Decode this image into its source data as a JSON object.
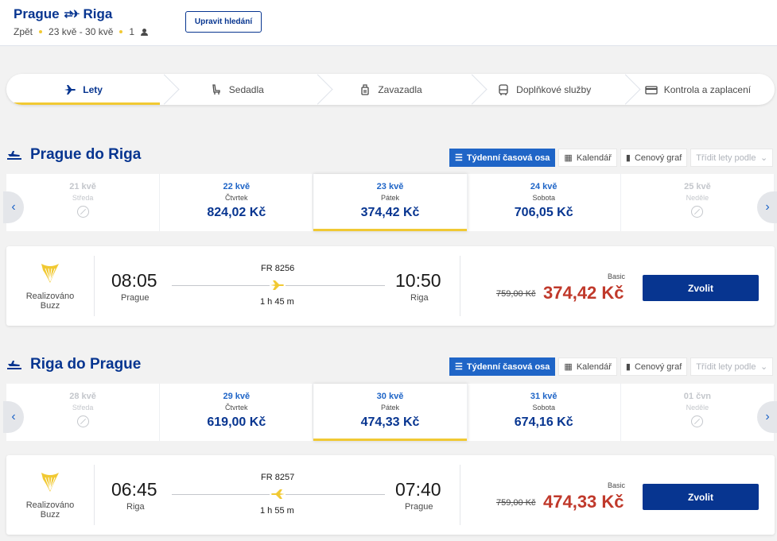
{
  "header": {
    "origin": "Prague",
    "destination": "Riga",
    "trip_type": "Zpět",
    "dates": "23 kvě - 30 kvě",
    "passengers": "1",
    "edit_label": "Upravit hledání"
  },
  "steps": [
    {
      "label": "Lety",
      "icon": "plane-icon"
    },
    {
      "label": "Sedadla",
      "icon": "seat-icon"
    },
    {
      "label": "Zavazadla",
      "icon": "luggage-icon"
    },
    {
      "label": "Doplňkové služby",
      "icon": "bus-icon"
    },
    {
      "label": "Kontrola a zaplacení",
      "icon": "card-icon"
    }
  ],
  "view_tabs": {
    "weekly": "Týdenní časová osa",
    "calendar": "Kalendář",
    "price_chart": "Cenový graf",
    "sort_placeholder": "Třídit lety podle"
  },
  "outbound": {
    "title": "Prague do Riga",
    "days": [
      {
        "date": "21 kvě",
        "weekday": "Středa",
        "price": ""
      },
      {
        "date": "22 kvě",
        "weekday": "Čtvrtek",
        "price": "824,02 Kč"
      },
      {
        "date": "23 kvě",
        "weekday": "Pátek",
        "price": "374,42 Kč"
      },
      {
        "date": "24 kvě",
        "weekday": "Sobota",
        "price": "706,05 Kč"
      },
      {
        "date": "25 kvě",
        "weekday": "Neděle",
        "price": ""
      }
    ],
    "flight": {
      "operator_line1": "Realizováno",
      "operator_line2": "Buzz",
      "depart_time": "08:05",
      "depart_city": "Prague",
      "flight_number": "FR 8256",
      "duration": "1 h 45 m",
      "arrive_time": "10:50",
      "arrive_city": "Riga",
      "fare": "Basic",
      "old_price": "759,00 Kč",
      "price": "374,42 Kč",
      "select_label": "Zvolit"
    }
  },
  "inbound": {
    "title": "Riga do Prague",
    "days": [
      {
        "date": "28 kvě",
        "weekday": "Středa",
        "price": ""
      },
      {
        "date": "29 kvě",
        "weekday": "Čtvrtek",
        "price": "619,00 Kč"
      },
      {
        "date": "30 kvě",
        "weekday": "Pátek",
        "price": "474,33 Kč"
      },
      {
        "date": "31 kvě",
        "weekday": "Sobota",
        "price": "674,16 Kč"
      },
      {
        "date": "01 čvn",
        "weekday": "Neděle",
        "price": ""
      }
    ],
    "flight": {
      "operator_line1": "Realizováno",
      "operator_line2": "Buzz",
      "depart_time": "06:45",
      "depart_city": "Riga",
      "flight_number": "FR 8257",
      "duration": "1 h 55 m",
      "arrive_time": "07:40",
      "arrive_city": "Prague",
      "fare": "Basic",
      "old_price": "759,00 Kč",
      "price": "474,33 Kč",
      "select_label": "Zvolit"
    }
  },
  "colors": {
    "brand": "#073590",
    "accent": "#f1c933",
    "price": "#c0392b",
    "link": "#1f65c7"
  }
}
